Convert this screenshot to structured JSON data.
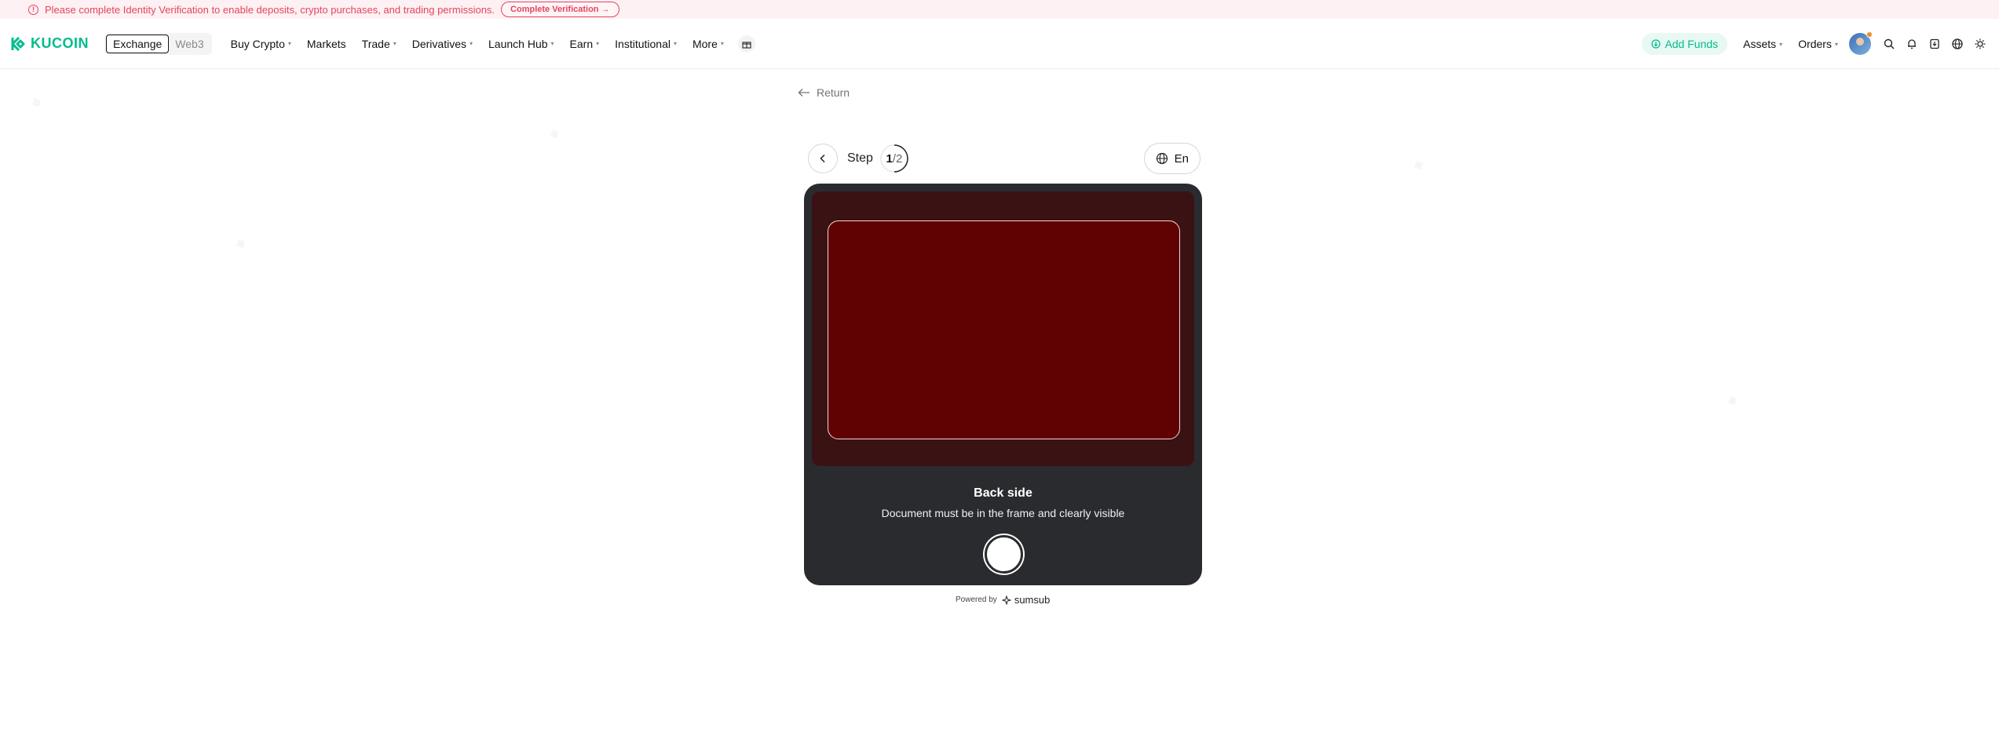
{
  "banner": {
    "message": "Please complete Identity Verification to enable deposits, crypto purchases, and trading permissions.",
    "button": "Complete Verification →"
  },
  "nav": {
    "logo": "KUCOIN",
    "switch": [
      "Exchange",
      "Web3"
    ],
    "items": [
      {
        "label": "Buy Crypto",
        "dropdown": true
      },
      {
        "label": "Markets",
        "dropdown": false
      },
      {
        "label": "Trade",
        "dropdown": true
      },
      {
        "label": "Derivatives",
        "dropdown": true
      },
      {
        "label": "Launch Hub",
        "dropdown": true
      },
      {
        "label": "Earn",
        "dropdown": true
      },
      {
        "label": "Institutional",
        "dropdown": true
      },
      {
        "label": "More",
        "dropdown": true
      }
    ],
    "add_funds": "Add Funds",
    "assets": "Assets",
    "orders": "Orders"
  },
  "content": {
    "return": "Return",
    "step_label": "Step",
    "step_current": "1",
    "step_total": "/2",
    "language": "En",
    "camera_title": "Back side",
    "camera_subtitle": "Document must be in the frame and clearly visible",
    "powered_by": "Powered by",
    "powered_brand": "sumsub"
  },
  "colors": {
    "brand": "#01bc8d",
    "alert": "#e5445e",
    "camera_bg": "#2a2b2f",
    "doc_frame": "#610202"
  }
}
